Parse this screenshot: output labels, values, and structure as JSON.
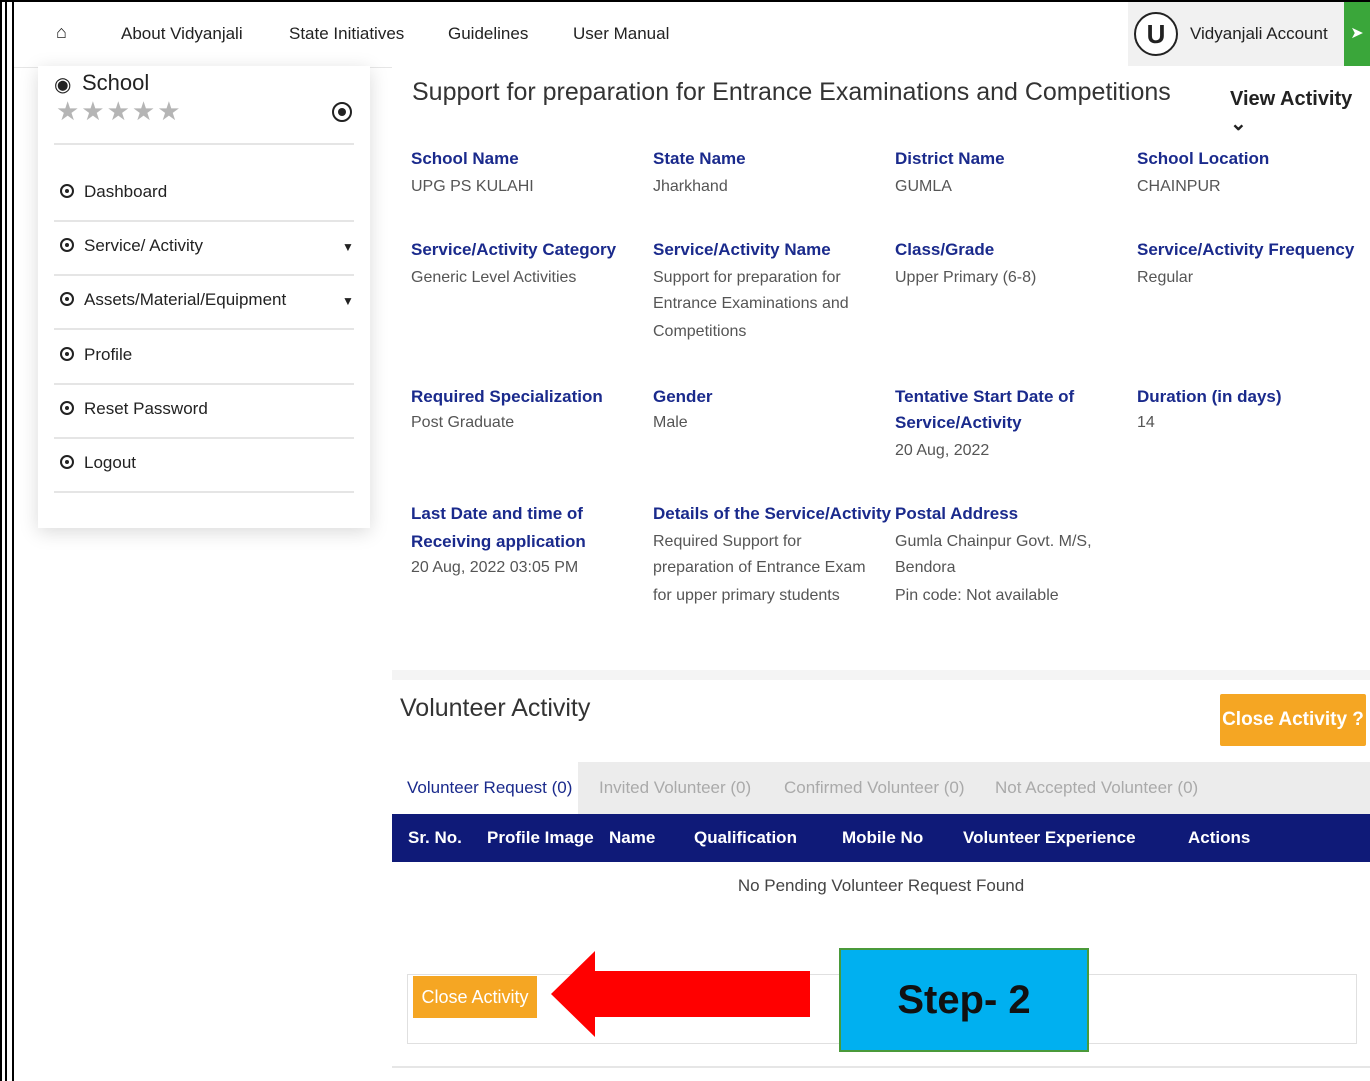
{
  "nav": {
    "items": [
      "About Vidyanjali",
      "State Initiatives",
      "Guidelines",
      "User Manual"
    ],
    "account_initial": "U",
    "account_label": "Vidyanjali Account"
  },
  "sidebar": {
    "title": "School",
    "stars": "★★★★★",
    "items": [
      {
        "label": "Dashboard",
        "dropdown": false
      },
      {
        "label": "Service/ Activity",
        "dropdown": true
      },
      {
        "label": "Assets/Material/Equipment",
        "dropdown": true
      },
      {
        "label": "Profile",
        "dropdown": false
      },
      {
        "label": "Reset Password",
        "dropdown": false
      },
      {
        "label": "Logout",
        "dropdown": false
      }
    ]
  },
  "activity": {
    "title": "Support for preparation for Entrance Examinations and Competitions",
    "view_label": "View Activity",
    "fields": {
      "school_name": {
        "label": "School Name",
        "value": "UPG PS KULAHI"
      },
      "state_name": {
        "label": "State Name",
        "value": "Jharkhand"
      },
      "district_name": {
        "label": "District Name",
        "value": "GUMLA"
      },
      "school_location": {
        "label": "School Location",
        "value": "CHAINPUR"
      },
      "category": {
        "label": "Service/Activity Category",
        "value": "Generic Level Activities"
      },
      "name": {
        "label": "Service/Activity Name",
        "value_lines": [
          "Support for preparation for",
          "Entrance Examinations and",
          "Competitions"
        ]
      },
      "class_grade": {
        "label": "Class/Grade",
        "value": "Upper Primary (6-8)"
      },
      "frequency": {
        "label": "Service/Activity Frequency",
        "value": "Regular"
      },
      "specialization": {
        "label": "Required Specialization",
        "value": "Post Graduate"
      },
      "gender": {
        "label": "Gender",
        "value": "Male"
      },
      "start_date": {
        "label_lines": [
          "Tentative Start Date of",
          "Service/Activity"
        ],
        "value": "20 Aug, 2022"
      },
      "duration": {
        "label": "Duration (in days)",
        "value": "14"
      },
      "last_date": {
        "label_lines": [
          "Last Date and time of",
          "Receiving application"
        ],
        "value": "20 Aug, 2022 03:05 PM"
      },
      "details": {
        "label": "Details of the Service/Activity",
        "value_lines": [
          "Required Support for",
          "preparation of Entrance Exam",
          "for upper primary students"
        ]
      },
      "postal": {
        "label": "Postal Address",
        "value_lines": [
          "Gumla Chainpur Govt. M/S,",
          "Bendora",
          "Pin code: Not available"
        ]
      }
    }
  },
  "volunteer": {
    "title": "Volunteer Activity",
    "close_top_label": "Close Activity ?",
    "tabs": [
      "Volunteer Request (0)",
      "Invited Volunteer (0)",
      "Confirmed Volunteer (0)",
      "Not Accepted Volunteer (0)"
    ],
    "columns": [
      "Sr. No.",
      "Profile Image",
      "Name",
      "Qualification",
      "Mobile No",
      "Volunteer Experience",
      "Actions"
    ],
    "empty_message": "No Pending Volunteer Request Found",
    "close_button_label": "Close Activity"
  },
  "annotation": {
    "step_label": "Step- 2"
  },
  "colors": {
    "navy": "#0f1a78",
    "label_blue": "#1a2a8c",
    "orange": "#f5a623",
    "green": "#3aa63a",
    "arrow_red": "#ff0000",
    "step_blue": "#00b0f0"
  }
}
